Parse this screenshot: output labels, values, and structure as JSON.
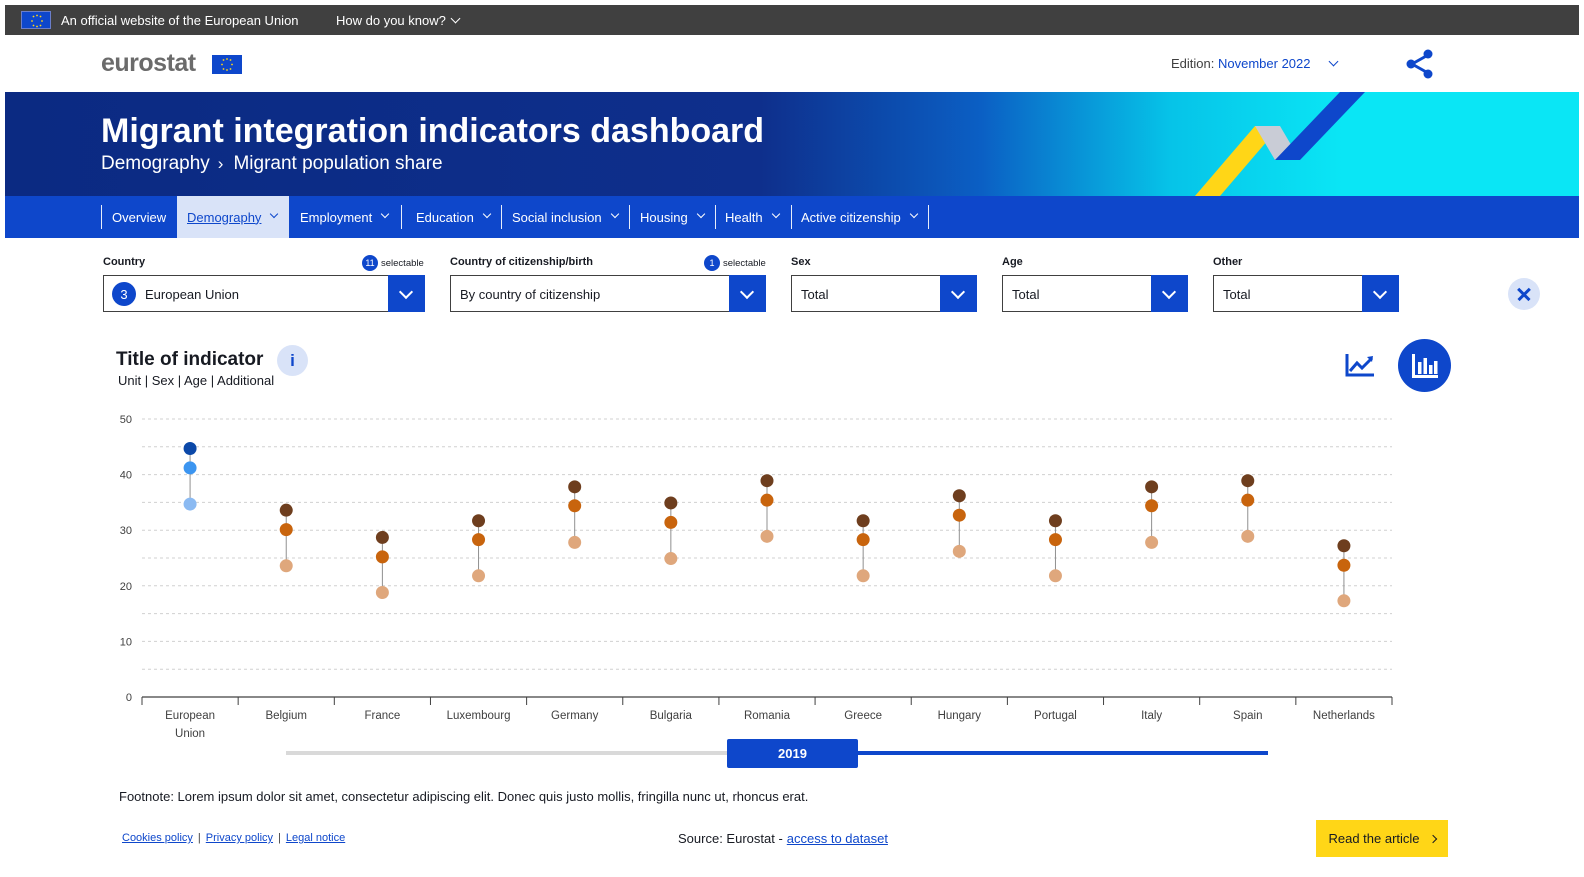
{
  "topbar": {
    "official_text": "An official website of the European Union",
    "how_label": "How do you know?"
  },
  "header": {
    "logo_text": "eurostat",
    "edition_label": "Edition:",
    "edition_value": "November 2022",
    "share_icon": "share-icon"
  },
  "banner": {
    "title": "Migrant integration indicators dashboard",
    "crumb_1": "Demography",
    "crumb_sep": "›",
    "crumb_2": "Migrant population share"
  },
  "nav": {
    "items": [
      {
        "label": "Overview"
      },
      {
        "label": "Demography"
      },
      {
        "label": "Employment"
      },
      {
        "label": "Education"
      },
      {
        "label": "Social inclusion"
      },
      {
        "label": "Housing"
      },
      {
        "label": "Health"
      },
      {
        "label": "Active citizenship"
      }
    ]
  },
  "filters": {
    "country": {
      "label": "Country",
      "count": "11",
      "selectable": "selectable",
      "badge": "3",
      "value": "European Union"
    },
    "citizenship": {
      "label": "Country of citizenship/birth",
      "count": "1",
      "selectable": "selectable",
      "value": "By country of citizenship"
    },
    "sex": {
      "label": "Sex",
      "value": "Total"
    },
    "age": {
      "label": "Age",
      "value": "Total"
    },
    "other": {
      "label": "Other",
      "value": "Total"
    }
  },
  "indicator": {
    "title": "Title of indicator",
    "info": "i",
    "subtitle": "Unit | Sex | Age | Additional"
  },
  "slider": {
    "year": "2019"
  },
  "footnote": "Footnote: Lorem ipsum dolor sit amet, consectetur adipiscing elit. Donec quis justo mollis, fringilla nunc ut, rhoncus erat.",
  "footer": {
    "cookies": "Cookies policy",
    "privacy": "Privacy policy",
    "legal": "Legal notice",
    "pipe": "|",
    "source_label": "Source: Eurostat -",
    "source_link": "access to dataset",
    "read_article": "Read the article"
  },
  "colors": {
    "primary": "#0e47cb",
    "eu_dark": "#0b48a8",
    "eu_mid": "#3c95f0",
    "eu_light": "#8bbaf2",
    "c_dark": "#6e3e1e",
    "c_mid": "#c8640d",
    "c_light": "#dfa77c",
    "accent_yellow": "#ffd617"
  },
  "chart_data": {
    "type": "scatter",
    "categories": [
      "European Union",
      "Belgium",
      "France",
      "Luxembourg",
      "Germany",
      "Bulgaria",
      "Romania",
      "Greece",
      "Hungary",
      "Portugal",
      "Italy",
      "Spain",
      "Netherlands"
    ],
    "category_lines": [
      [
        "European",
        "Union"
      ],
      [
        "Belgium"
      ],
      [
        "France"
      ],
      [
        "Luxembourg"
      ],
      [
        "Germany"
      ],
      [
        "Bulgaria"
      ],
      [
        "Romania"
      ],
      [
        "Greece"
      ],
      [
        "Hungary"
      ],
      [
        "Portugal"
      ],
      [
        "Italy"
      ],
      [
        "Spain"
      ],
      [
        "Netherlands"
      ]
    ],
    "series": [
      {
        "values": [
          44.7,
          33.6,
          28.7,
          31.7,
          37.8,
          34.9,
          38.9,
          31.7,
          36.2,
          31.7,
          37.8,
          38.9,
          27.2
        ]
      },
      {
        "values": [
          41.2,
          30.1,
          25.2,
          28.3,
          34.4,
          31.4,
          35.4,
          28.3,
          32.7,
          28.3,
          34.4,
          35.4,
          23.7
        ]
      },
      {
        "values": [
          34.7,
          23.6,
          18.8,
          21.8,
          27.8,
          24.9,
          28.9,
          21.8,
          26.2,
          21.8,
          27.8,
          28.9,
          17.3
        ]
      }
    ],
    "ylim": [
      0,
      50
    ],
    "yticks": [
      "0",
      "10",
      "20",
      "30",
      "40",
      "50"
    ],
    "grid": true
  }
}
